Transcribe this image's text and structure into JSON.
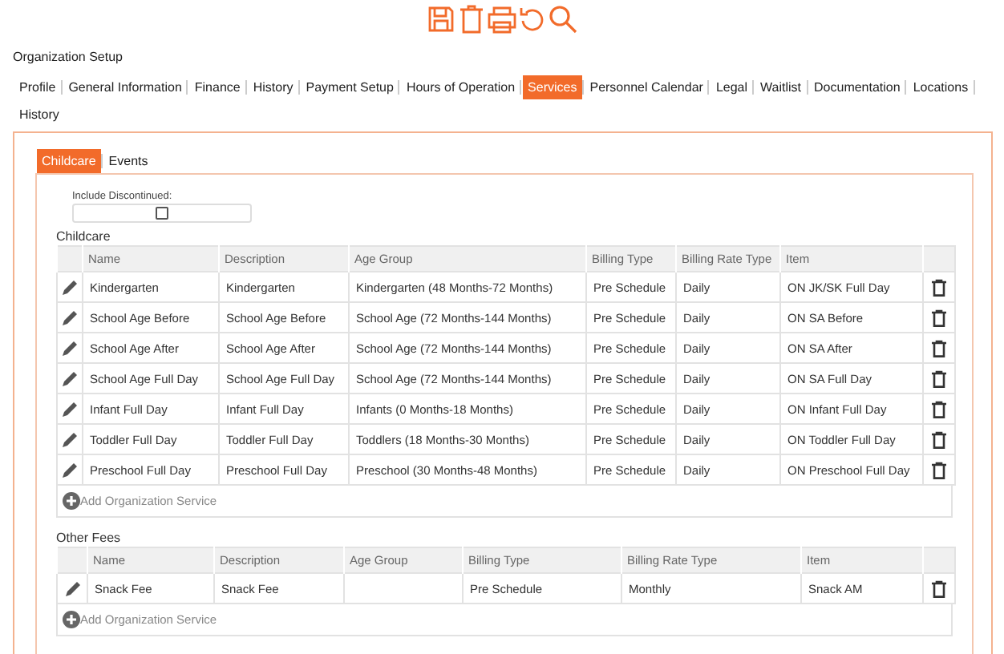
{
  "page_title": "Organization Setup",
  "tabs": [
    {
      "label": "Profile",
      "selected": false
    },
    {
      "label": "General Information",
      "selected": false
    },
    {
      "label": "Finance",
      "selected": false
    },
    {
      "label": "History",
      "selected": false
    },
    {
      "label": "Payment Setup",
      "selected": false
    },
    {
      "label": "Hours of Operation",
      "selected": false
    },
    {
      "label": "Services",
      "selected": true
    },
    {
      "label": "Personnel Calendar",
      "selected": false
    },
    {
      "label": "Legal",
      "selected": false
    },
    {
      "label": "Waitlist",
      "selected": false
    },
    {
      "label": "Documentation",
      "selected": false
    },
    {
      "label": "Locations",
      "selected": false
    },
    {
      "label": "History",
      "selected": false
    }
  ],
  "sub_tabs": [
    {
      "label": "Childcare",
      "selected": true
    },
    {
      "label": "Events",
      "selected": false
    }
  ],
  "include_discontinued": {
    "label": "Include Discontinued:",
    "checked": false
  },
  "sections": [
    {
      "title": "Childcare",
      "columns": [
        "Name",
        "Description",
        "Age Group",
        "Billing Type",
        "Billing Rate Type",
        "Item"
      ],
      "rows": [
        [
          "Kindergarten",
          "Kindergarten",
          "Kindergarten (48 Months-72 Months)",
          "Pre Schedule",
          "Daily",
          "ON JK/SK Full Day"
        ],
        [
          "School Age Before",
          "School Age Before",
          "School Age (72 Months-144 Months)",
          "Pre Schedule",
          "Daily",
          "ON SA Before"
        ],
        [
          "School Age After",
          "School Age After",
          "School Age (72 Months-144 Months)",
          "Pre Schedule",
          "Daily",
          "ON SA After"
        ],
        [
          "School Age Full Day",
          "School Age Full Day",
          "School Age (72 Months-144 Months)",
          "Pre Schedule",
          "Daily",
          "ON SA Full Day"
        ],
        [
          "Infant Full Day",
          "Infant Full Day",
          "Infants (0 Months-18 Months)",
          "Pre Schedule",
          "Daily",
          "ON Infant Full Day"
        ],
        [
          "Toddler Full Day",
          "Toddler Full Day",
          "Toddlers (18 Months-30 Months)",
          "Pre Schedule",
          "Daily",
          "ON Toddler Full Day"
        ],
        [
          "Preschool Full Day",
          "Preschool Full Day",
          "Preschool (30 Months-48 Months)",
          "Pre Schedule",
          "Daily",
          "ON Preschool Full Day"
        ]
      ],
      "add_label": "Add Organization Service"
    },
    {
      "title": "Other Fees",
      "columns": [
        "Name",
        "Description",
        "Age Group",
        "Billing Type",
        "Billing Rate Type",
        "Item"
      ],
      "rows": [
        [
          "Snack Fee",
          "Snack Fee",
          null,
          "Pre Schedule",
          "Monthly",
          "Snack AM"
        ]
      ],
      "add_label": "Add Organization Service"
    }
  ]
}
